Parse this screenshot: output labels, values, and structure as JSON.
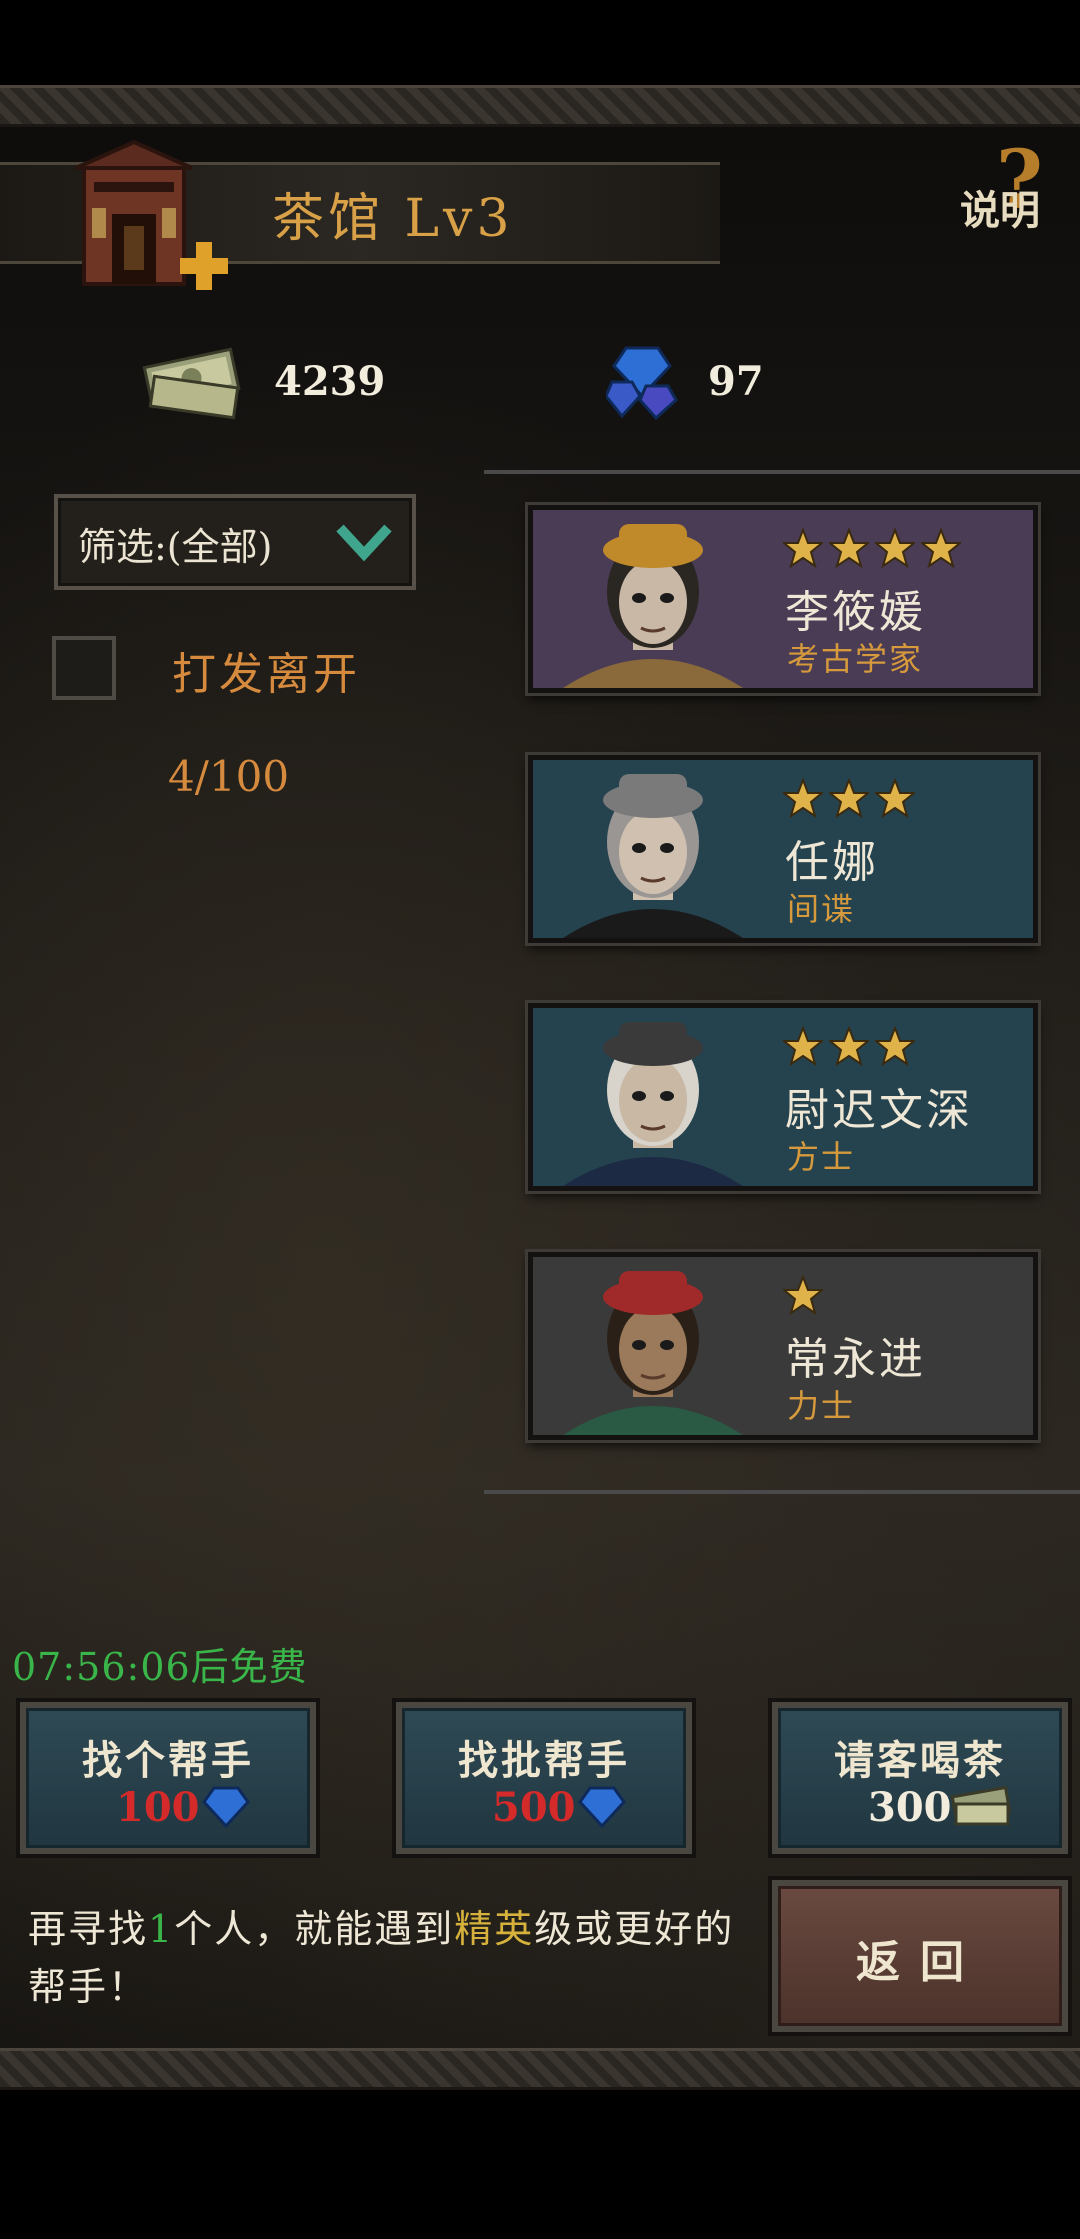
{
  "header": {
    "title": "茶馆  Lv3",
    "help_label": "说明",
    "help_mark": "?"
  },
  "currency": {
    "money": "4239",
    "gems": "97"
  },
  "filter": {
    "label": "筛选:(全部)"
  },
  "dismiss": {
    "label": "打发离开",
    "checked": false
  },
  "roster_count": "4/100",
  "heroes": [
    {
      "name": "李筱媛",
      "class": "考古学家",
      "stars": 4,
      "bg": "#4a3c55"
    },
    {
      "name": "任娜",
      "class": "间谍",
      "stars": 3,
      "bg": "#25434f"
    },
    {
      "name": "尉迟文深",
      "class": "方士",
      "stars": 3,
      "bg": "#25434f"
    },
    {
      "name": "常永进",
      "class": "力士",
      "stars": 1,
      "bg": "#3a3a3a"
    }
  ],
  "timer": "07:56:06后免费",
  "actions": [
    {
      "label": "找个帮手",
      "cost": "100",
      "cost_color": "#d42a2a",
      "icon": "gem-icon"
    },
    {
      "label": "找批帮手",
      "cost": "500",
      "cost_color": "#d42a2a",
      "icon": "gem-icon"
    },
    {
      "label": "请客喝茶",
      "cost": "300",
      "cost_color": "#f2ecdd",
      "icon": "money-icon"
    }
  ],
  "back_label": "返回",
  "hint": {
    "part1": "再寻找",
    "num": "1",
    "part2": "个人，就能遇到",
    "elite": "精英",
    "part3": "级或更好的帮手！"
  },
  "colors": {
    "accent_orange": "#d58a3e",
    "timer_green": "#39b54a",
    "star_gold": "#e0b24a"
  }
}
